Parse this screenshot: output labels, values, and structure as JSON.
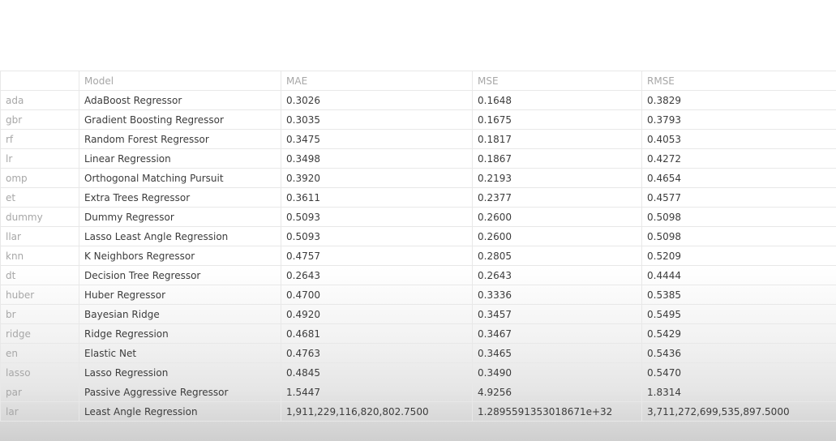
{
  "table": {
    "columns": [
      "",
      "Model",
      "MAE",
      "MSE",
      "RMSE"
    ],
    "rows": [
      [
        "ada",
        "AdaBoost Regressor",
        "0.3026",
        "0.1648",
        "0.3829"
      ],
      [
        "gbr",
        "Gradient Boosting Regressor",
        "0.3035",
        "0.1675",
        "0.3793"
      ],
      [
        "rf",
        "Random Forest Regressor",
        "0.3475",
        "0.1817",
        "0.4053"
      ],
      [
        "lr",
        "Linear Regression",
        "0.3498",
        "0.1867",
        "0.4272"
      ],
      [
        "omp",
        "Orthogonal Matching Pursuit",
        "0.3920",
        "0.2193",
        "0.4654"
      ],
      [
        "et",
        "Extra Trees Regressor",
        "0.3611",
        "0.2377",
        "0.4577"
      ],
      [
        "dummy",
        "Dummy Regressor",
        "0.5093",
        "0.2600",
        "0.5098"
      ],
      [
        "llar",
        "Lasso Least Angle Regression",
        "0.5093",
        "0.2600",
        "0.5098"
      ],
      [
        "knn",
        "K Neighbors Regressor",
        "0.4757",
        "0.2805",
        "0.5209"
      ],
      [
        "dt",
        "Decision Tree Regressor",
        "0.2643",
        "0.2643",
        "0.4444"
      ],
      [
        "huber",
        "Huber Regressor",
        "0.4700",
        "0.3336",
        "0.5385"
      ],
      [
        "br",
        "Bayesian Ridge",
        "0.4920",
        "0.3457",
        "0.5495"
      ],
      [
        "ridge",
        "Ridge Regression",
        "0.4681",
        "0.3467",
        "0.5429"
      ],
      [
        "en",
        "Elastic Net",
        "0.4763",
        "0.3465",
        "0.5436"
      ],
      [
        "lasso",
        "Lasso Regression",
        "0.4845",
        "0.3490",
        "0.5470"
      ],
      [
        "par",
        "Passive Aggressive Regressor",
        "1.5447",
        "4.9256",
        "1.8314"
      ],
      [
        "lar",
        "Least Angle Regression",
        "1,911,229,116,820,802.7500",
        "1.2895591353018671e+32",
        "3,711,272,699,535,897.5000"
      ]
    ]
  }
}
